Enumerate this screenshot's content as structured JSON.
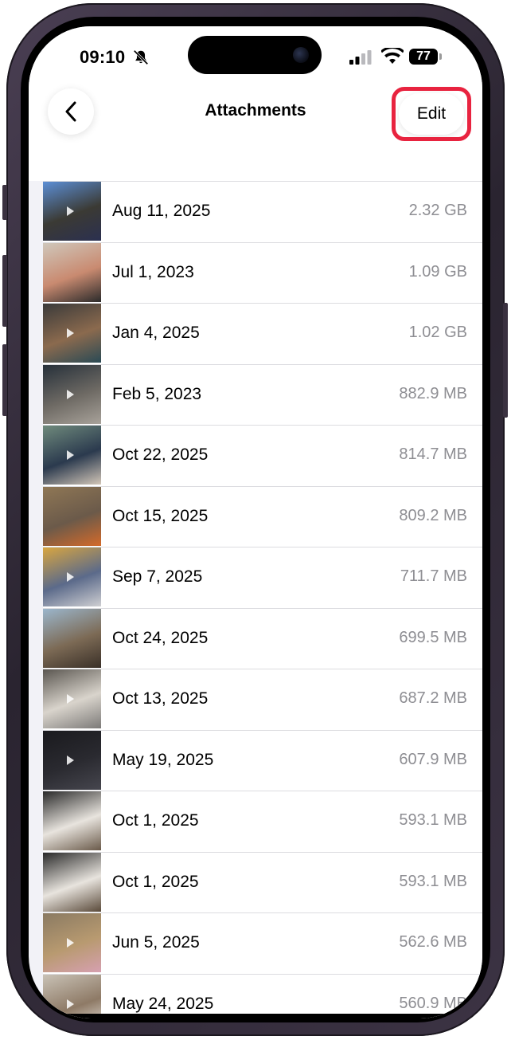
{
  "status_bar": {
    "time": "09:10",
    "battery": "77"
  },
  "nav": {
    "back_icon": "chevron-left-icon",
    "title": "Attachments",
    "edit_label": "Edit",
    "highlight_color": "#e8233f"
  },
  "attachments": [
    {
      "date": "Aug 11, 2025",
      "size": "2.32 GB",
      "thumb": [
        "#5c8fd6",
        "#3b3a34",
        "#2b3050"
      ],
      "video": true
    },
    {
      "date": "Jul 1, 2023",
      "size": "1.09 GB",
      "thumb": [
        "#cfc7bb",
        "#c98a70",
        "#2b2b2b"
      ],
      "video": false
    },
    {
      "date": "Jan 4, 2025",
      "size": "1.02 GB",
      "thumb": [
        "#3a3a3a",
        "#8b6a4e",
        "#2a4a55"
      ],
      "video": true
    },
    {
      "date": "Feb 5, 2023",
      "size": "882.9 MB",
      "thumb": [
        "#26303a",
        "#6e6a64",
        "#a8a29a"
      ],
      "video": true
    },
    {
      "date": "Oct 22, 2025",
      "size": "814.7 MB",
      "thumb": [
        "#6f8a7c",
        "#2b3a4e",
        "#d2c6b8"
      ],
      "video": true
    },
    {
      "date": "Oct 15, 2025",
      "size": "809.2 MB",
      "thumb": [
        "#8f7755",
        "#6b5a4a",
        "#d46a2a"
      ],
      "video": false
    },
    {
      "date": "Sep 7, 2025",
      "size": "711.7 MB",
      "thumb": [
        "#d9a640",
        "#5b6a8a",
        "#cfcfd2"
      ],
      "video": true
    },
    {
      "date": "Oct 24, 2025",
      "size": "699.5 MB",
      "thumb": [
        "#9bb6cc",
        "#7c6a55",
        "#3a3028"
      ],
      "video": false
    },
    {
      "date": "Oct 13, 2025",
      "size": "687.2 MB",
      "thumb": [
        "#5a5650",
        "#d9d4cc",
        "#7c7a78"
      ],
      "video": true
    },
    {
      "date": "May 19, 2025",
      "size": "607.9 MB",
      "thumb": [
        "#1a1a1e",
        "#2a2a30",
        "#46464e"
      ],
      "video": true
    },
    {
      "date": "Oct 1, 2025",
      "size": "593.1 MB",
      "thumb": [
        "#2a2a2a",
        "#e8e4de",
        "#6a5a4a"
      ],
      "video": false
    },
    {
      "date": "Oct 1, 2025",
      "size": "593.1 MB",
      "thumb": [
        "#2a2a2a",
        "#e8e4de",
        "#5a4a3a"
      ],
      "video": false
    },
    {
      "date": "Jun 5, 2025",
      "size": "562.6 MB",
      "thumb": [
        "#8a7a62",
        "#b89a70",
        "#d6a0b0"
      ],
      "video": true
    },
    {
      "date": "May 24, 2025",
      "size": "560.9 MB",
      "thumb": [
        "#c9c2b6",
        "#8e7a66",
        "#f0ece6"
      ],
      "video": true
    }
  ]
}
